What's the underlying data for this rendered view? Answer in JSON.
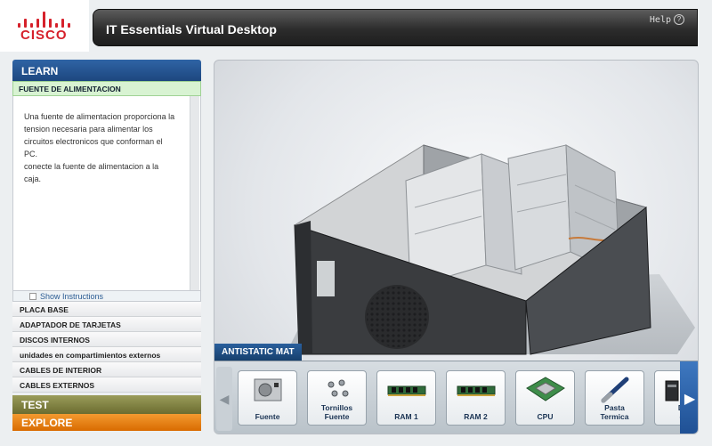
{
  "header": {
    "logo_text": "CISCO",
    "title": "IT Essentials Virtual Desktop",
    "help_label": "Help",
    "help_icon_glyph": "?"
  },
  "learn": {
    "header": "LEARN",
    "section_title": "FUENTE DE ALIMENTACION",
    "instructions": [
      "Una fuente de alimentacion proporciona la tension necesaria para alimentar los circuitos electronicos que conforman el PC.",
      "conecte la fuente de alimentacion a la caja."
    ],
    "show_instructions_label": "Show Instructions"
  },
  "menu": {
    "items": [
      "PLACA BASE",
      "ADAPTADOR DE TARJETAS",
      "DISCOS INTERNOS",
      "unidades en compartimientos externos",
      "CABLES DE INTERIOR",
      "CABLES EXTERNOS"
    ]
  },
  "sections": {
    "test": "TEST",
    "explore": "EXPLORE"
  },
  "tray": {
    "label": "ANTISTATIC MAT",
    "parts": [
      {
        "label_line1": "Fuente",
        "label_line2": "",
        "icon": "power-supply-icon"
      },
      {
        "label_line1": "Tornillos",
        "label_line2": "Fuente",
        "icon": "screws-icon"
      },
      {
        "label_line1": "RAM 1",
        "label_line2": "",
        "icon": "ram-icon"
      },
      {
        "label_line1": "RAM 2",
        "label_line2": "",
        "icon": "ram-icon"
      },
      {
        "label_line1": "CPU",
        "label_line2": "",
        "icon": "cpu-icon"
      },
      {
        "label_line1": "Pasta",
        "label_line2": "Termica",
        "icon": "thermal-paste-icon"
      },
      {
        "label_line1": "Dis",
        "label_line2": "da",
        "icon": "disk-icon"
      }
    ]
  },
  "colors": {
    "brand_red": "#d6212b",
    "learn_blue": "#1d477f",
    "explore_orange": "#e07a10",
    "test_olive": "#7c7d3e"
  }
}
